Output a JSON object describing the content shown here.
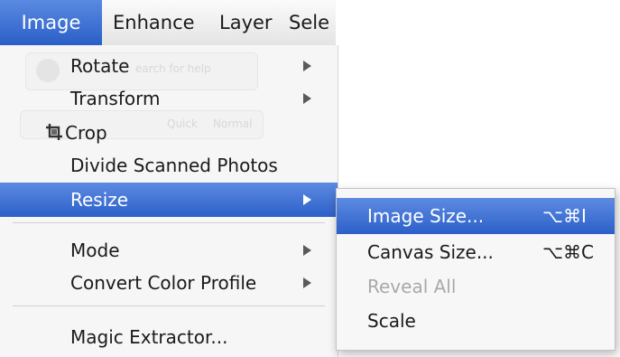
{
  "menubar": {
    "items": [
      "Image",
      "Enhance",
      "Layer",
      "Sele"
    ],
    "active": "Image"
  },
  "image_menu": {
    "items": [
      {
        "label": "Rotate",
        "submenu": true
      },
      {
        "label": "Transform",
        "submenu": true
      },
      {
        "label": "Crop",
        "icon": "crop-icon"
      },
      {
        "label": "Divide Scanned Photos"
      },
      {
        "label": "Resize",
        "submenu": true,
        "highlighted": true
      },
      {
        "label": "Mode",
        "submenu": true
      },
      {
        "label": "Convert Color Profile",
        "submenu": true
      },
      {
        "label": "Magic Extractor..."
      }
    ]
  },
  "resize_submenu": {
    "items": [
      {
        "label": "Image Size...",
        "shortcut": "⌥⌘I",
        "highlighted": true
      },
      {
        "label": "Canvas Size...",
        "shortcut": "⌥⌘C"
      },
      {
        "label": "Reveal All",
        "disabled": true
      },
      {
        "label": "Scale"
      }
    ]
  },
  "background": {
    "ghost_text": [
      "earch for help",
      "Quick",
      "Normal"
    ]
  },
  "colors": {
    "highlight": "#2c60c9",
    "menu_bg": "#f6f6f6",
    "disabled": "#a9a9a9"
  }
}
